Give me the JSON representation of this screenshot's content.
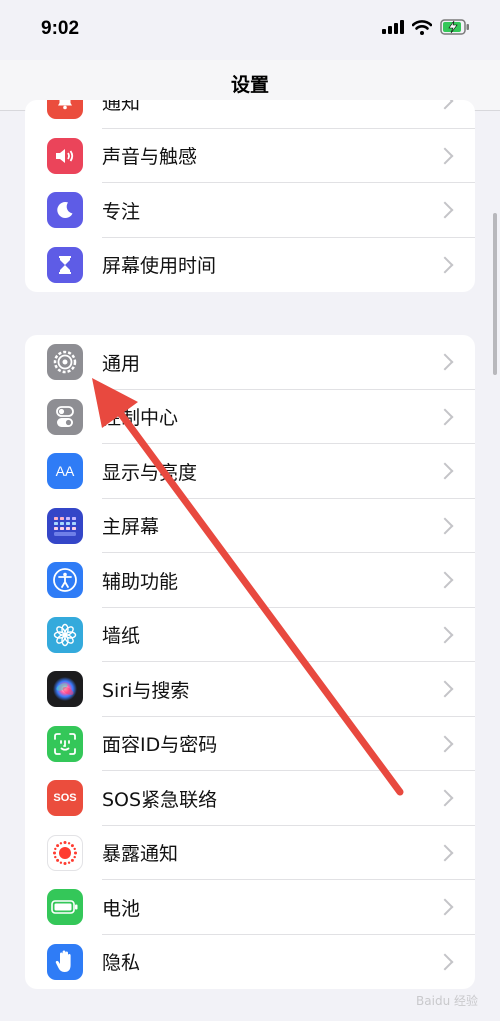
{
  "status": {
    "time": "9:02"
  },
  "nav": {
    "title": "设置"
  },
  "group1": {
    "items": [
      {
        "label": "通知",
        "icon": "bell-icon",
        "color": "#eb4d3d"
      },
      {
        "label": "声音与触感",
        "icon": "speaker-icon",
        "color": "#eb445a"
      },
      {
        "label": "专注",
        "icon": "moon-icon",
        "color": "#5e5ce6"
      },
      {
        "label": "屏幕使用时间",
        "icon": "hourglass-icon",
        "color": "#5e5ce6"
      }
    ]
  },
  "group2": {
    "items": [
      {
        "label": "通用",
        "icon": "gear-icon",
        "color": "#8e8e93"
      },
      {
        "label": "控制中心",
        "icon": "toggles-icon",
        "color": "#8e8e93"
      },
      {
        "label": "显示与亮度",
        "icon": "aa-icon",
        "color": "#2f7cf6"
      },
      {
        "label": "主屏幕",
        "icon": "home-grid-icon",
        "color": "#3446c8"
      },
      {
        "label": "辅助功能",
        "icon": "accessibility-icon",
        "color": "#2f7cf6"
      },
      {
        "label": "墙纸",
        "icon": "flower-icon",
        "color": "#34aadc"
      },
      {
        "label": "Siri与搜索",
        "icon": "siri-icon",
        "color": "#1c1c1e"
      },
      {
        "label": "面容ID与密码",
        "icon": "faceid-icon",
        "color": "#34c759"
      },
      {
        "label": "SOS紧急联络",
        "icon": "sos-icon",
        "color": "#eb4d3d"
      },
      {
        "label": "暴露通知",
        "icon": "exposure-icon",
        "color": "#ffffff"
      },
      {
        "label": "电池",
        "icon": "battery-icon",
        "color": "#34c759"
      },
      {
        "label": "隐私",
        "icon": "hand-icon",
        "color": "#2f7cf6"
      }
    ]
  },
  "icon_text": {
    "aa": "AA",
    "sos": "SOS"
  },
  "watermark": "Baidu 经验"
}
